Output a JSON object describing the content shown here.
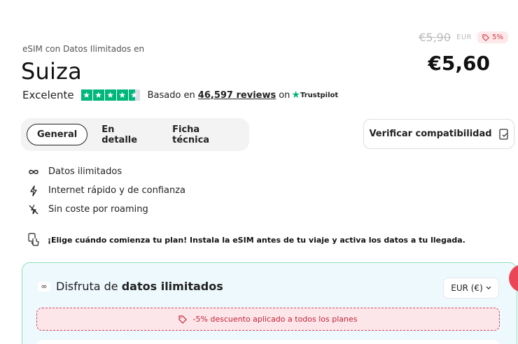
{
  "header": {
    "subtitle": "eSIM con Datos Ilimitados en",
    "country": "Suiza"
  },
  "rating": {
    "word": "Excelente",
    "stars": 4.5,
    "based_prefix": "Basado en",
    "reviews": "46,597 reviews",
    "on": "on",
    "provider": "Trustpilot"
  },
  "price": {
    "old": "€5,90",
    "currency_code": "EUR",
    "discount": "5%",
    "new": "€5,60"
  },
  "tabs": [
    {
      "label": "General",
      "active": true
    },
    {
      "label": "En detalle",
      "active": false
    },
    {
      "label": "Ficha técnica",
      "active": false
    }
  ],
  "compat_button": "Verificar compatibilidad",
  "features": [
    {
      "icon": "infinity-icon",
      "label": "Datos ilimitados"
    },
    {
      "icon": "lightning-icon",
      "label": "Internet rápido y de confianza"
    },
    {
      "icon": "no-roaming-icon",
      "label": "Sin coste por roaming"
    }
  ],
  "notice": "¡Elige cuándo comienza tu plan! Instala la eSIM antes de tu viaje y activa los datos a tu llegada.",
  "panel": {
    "title_prefix": "Disfruta de",
    "title_bold": "datos ilimitados",
    "currency_selector": "EUR (€)",
    "discount_text": "-5% descuento aplicado a todos los planes"
  },
  "colors": {
    "trustpilot_green": "#00b67a",
    "discount_red": "#d63545",
    "panel_bg": "#eef9fd",
    "panel_border": "#8fe0b8",
    "fab": "#ea4656"
  }
}
